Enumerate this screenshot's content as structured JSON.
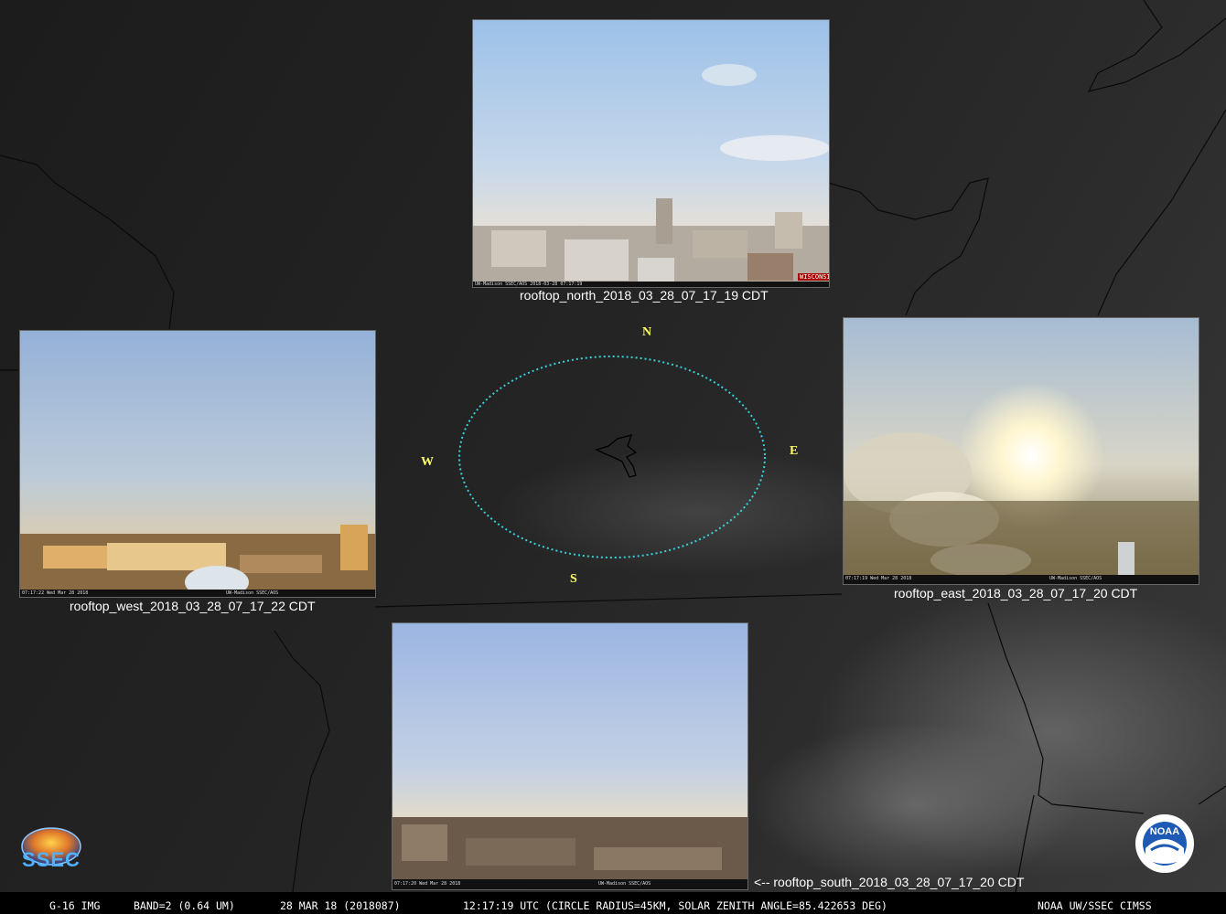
{
  "cameras": {
    "north": {
      "caption": "rooftop_north_2018_03_28_07_17_19 CDT",
      "overlay": "UW-Madison SSEC/AOS 2018-03-28 07:17:19",
      "brand": "WISCONSIN"
    },
    "west": {
      "caption": "rooftop_west_2018_03_28_07_17_22 CDT",
      "timestamp": "07:17:22 Wed Mar 28 2018",
      "overlay": "UW-Madison SSEC/AOS"
    },
    "east": {
      "caption": "rooftop_east_2018_03_28_07_17_20 CDT",
      "timestamp": "07:17:19 Wed Mar 28 2018",
      "overlay": "UW-Madison SSEC/AOS"
    },
    "south": {
      "caption": "<-- rooftop_south_2018_03_28_07_17_20 CDT",
      "timestamp": "07:17:20 Wed Mar 28 2018",
      "overlay": "UW-Madison SSEC/AOS"
    }
  },
  "compass": {
    "n": "N",
    "s": "S",
    "e": "E",
    "w": "W"
  },
  "status": {
    "satellite": "G-16 IMG",
    "band": "BAND=2 (0.64 UM)",
    "date": "28 MAR 18 (2018087)",
    "time": "12:17:19 UTC (CIRCLE RADIUS=45KM, SOLAR ZENITH ANGLE=85.422653 DEG)",
    "credit": "NOAA UW/SSEC CIMSS"
  },
  "logos": {
    "ssec": "SSEC",
    "noaa": "NOAA"
  },
  "colors": {
    "circle": "#3ad0d8",
    "compass": "#ffff66",
    "caption": "#ffffff"
  }
}
